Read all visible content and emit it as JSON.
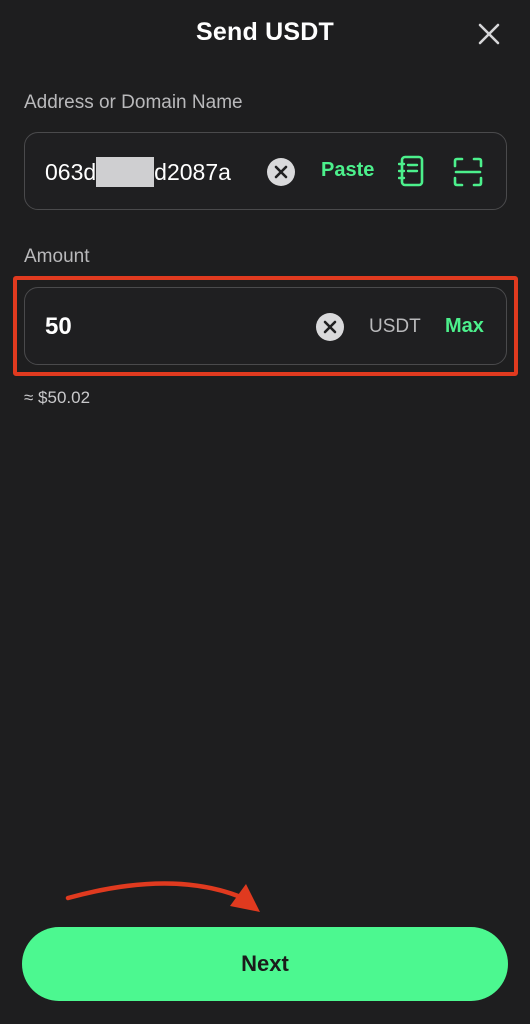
{
  "header": {
    "title": "Send USDT"
  },
  "address": {
    "label": "Address or Domain Name",
    "value_start": "063d",
    "value_end": "d2087a",
    "paste_label": "Paste"
  },
  "amount": {
    "label": "Amount",
    "value": "50",
    "unit": "USDT",
    "max_label": "Max",
    "fiat_estimate": "≈ $50.02"
  },
  "footer": {
    "next_label": "Next"
  },
  "colors": {
    "background": "#1e1e1f",
    "accent_green": "#4cf890",
    "highlight_red": "#e03a1f"
  },
  "icons": {
    "close": "close-icon",
    "clear": "clear-circle-x-icon",
    "address_book": "address-book-icon",
    "scan": "scan-qr-icon"
  }
}
